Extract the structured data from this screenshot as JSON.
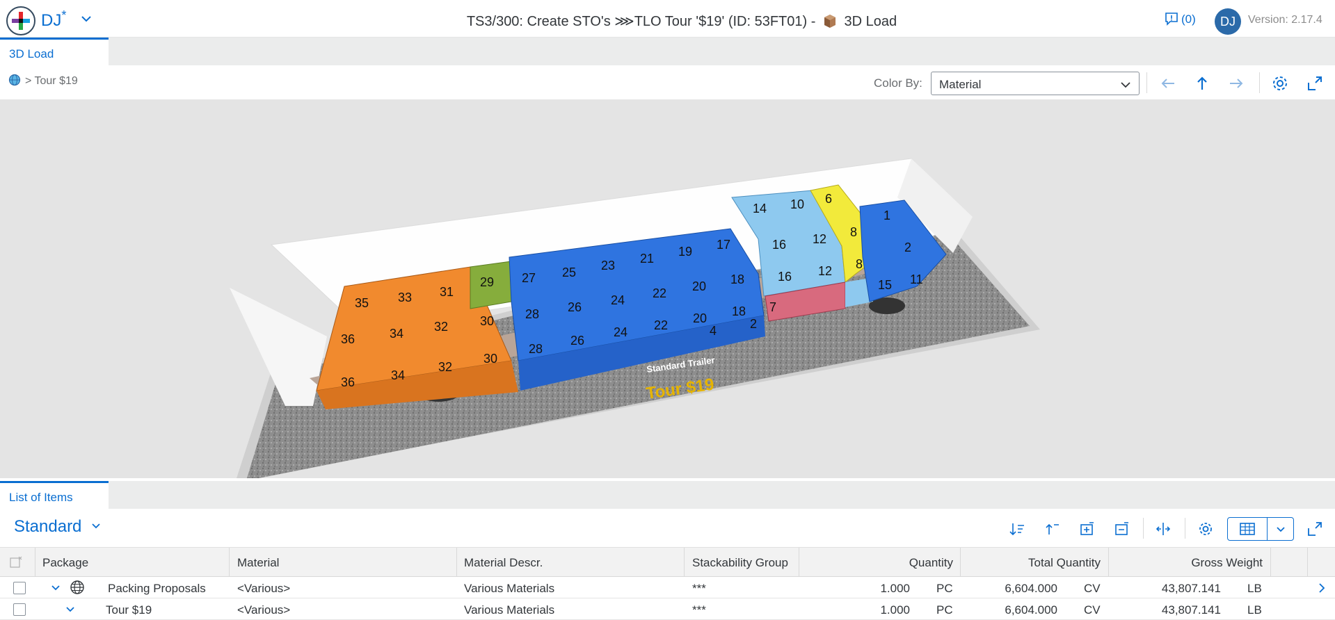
{
  "shell": {
    "app_name": "DJ",
    "app_marker": "*",
    "title_prefix": "TS3/300: Create STO's ⋙TLO Tour '$19' (ID: 53FT01) -",
    "title_suffix": "3D Load",
    "notifications": "(0)",
    "avatar_initials": "DJ",
    "version": "Version: 2.17.4"
  },
  "tabs": {
    "load_tab": "3D Load"
  },
  "subbar": {
    "breadcrumb": "> Tour $19",
    "color_by_label": "Color By:",
    "color_by_value": "Material"
  },
  "scene": {
    "trailer_label": "Standard Trailer",
    "tour_label": "Tour $19",
    "colors": {
      "orange": "#f18a2e",
      "green": "#86ad3c",
      "blue": "#2f74e0",
      "light_blue": "#8ec9ef",
      "yellow": "#f2ea3b",
      "pink": "#d86a7e"
    },
    "box_labels": [
      "35",
      "33",
      "31",
      "29",
      "27",
      "25",
      "23",
      "21",
      "19",
      "17",
      "14",
      "10",
      "6",
      "1",
      "36",
      "34",
      "32",
      "30",
      "28",
      "26",
      "24",
      "22",
      "20",
      "18",
      "16",
      "12",
      "8",
      "2",
      "36",
      "34",
      "32",
      "30",
      "28",
      "26",
      "24",
      "22",
      "20",
      "18",
      "16",
      "12",
      "8",
      "4",
      "2",
      "15",
      "11",
      "7"
    ]
  },
  "list": {
    "tab": "List of Items",
    "variant": "Standard",
    "columns": [
      "Package",
      "Material",
      "Material Descr.",
      "Stackability Group",
      "Quantity",
      "Total Quantity",
      "Gross Weight"
    ],
    "rows": [
      {
        "package": "Packing Proposals",
        "material": "<Various>",
        "descr": "Various Materials",
        "stack": "***",
        "qty": "1.000",
        "qty_unit": "PC",
        "total": "6,604.000",
        "total_unit": "CV",
        "weight": "43,807.141",
        "weight_unit": "LB"
      },
      {
        "package": "Tour $19",
        "material": "<Various>",
        "descr": "Various Materials",
        "stack": "***",
        "qty": "1.000",
        "qty_unit": "PC",
        "total": "6,604.000",
        "total_unit": "CV",
        "weight": "43,807.141",
        "weight_unit": "LB"
      }
    ]
  }
}
